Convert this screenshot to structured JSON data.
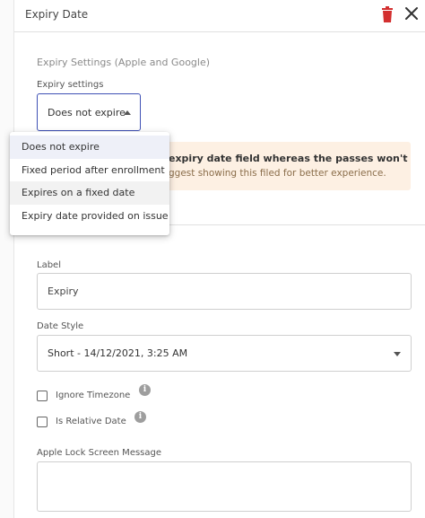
{
  "header": {
    "title": "Expiry Date",
    "delete_icon": "trash-icon",
    "close_icon": "close-icon"
  },
  "expiry": {
    "section_title": "Expiry Settings (Apple and Google)",
    "settings_label": "Expiry settings",
    "selected_value": "Does not expire",
    "options": [
      "Does not expire",
      "Fixed period after enrollment",
      "Expires on a fixed date",
      "Expiry date provided on issue"
    ]
  },
  "warning": {
    "line1": "expiry date field whereas the passes won't",
    "line2": "ggest showing this filed for better experience."
  },
  "label_field": {
    "label": "Label",
    "value": "Expiry"
  },
  "date_style": {
    "label": "Date Style",
    "value": "Short - 14/12/2021, 3:25 AM"
  },
  "checkboxes": {
    "ignore_timezone": "Ignore Timezone",
    "is_relative_date": "Is Relative Date",
    "info_glyph": "i"
  },
  "lock_screen": {
    "label": "Apple Lock Screen Message"
  },
  "colors": {
    "accent": "#3f51b5",
    "danger": "#d32f2f",
    "warning_bg": "#fdf0e3"
  }
}
